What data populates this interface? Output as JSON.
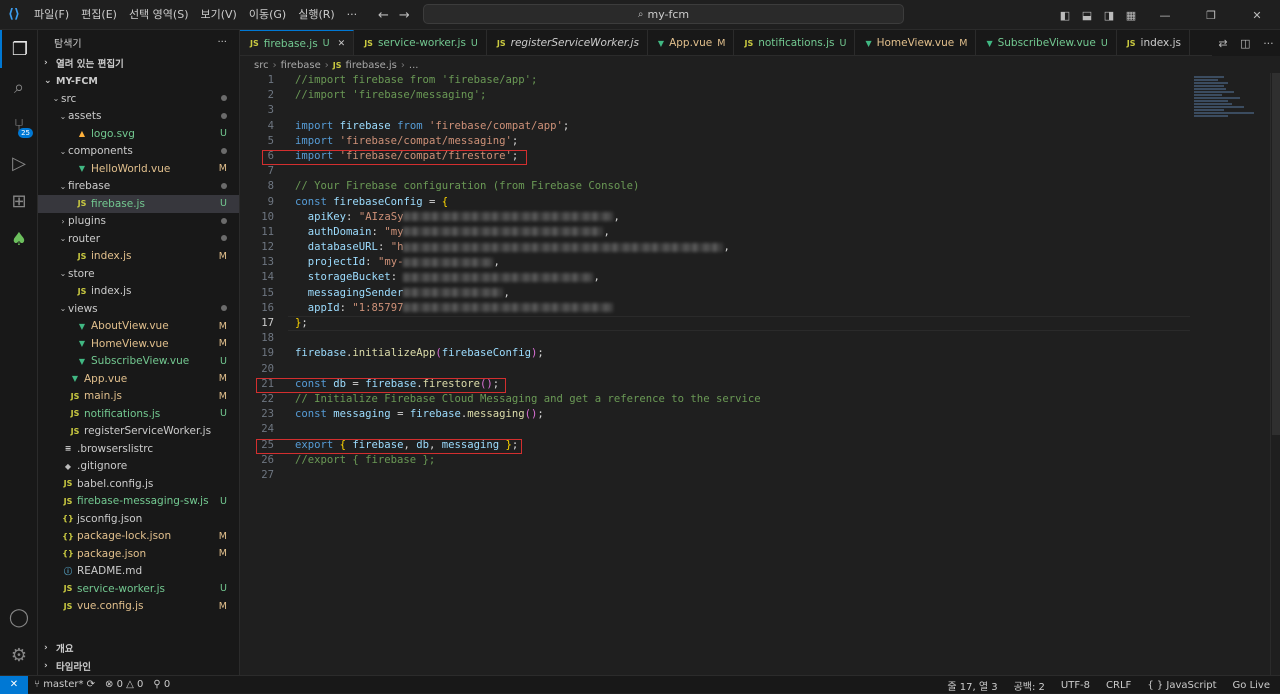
{
  "titlebar": {
    "menus": [
      "파일(F)",
      "편집(E)",
      "선택 영역(S)",
      "보기(V)",
      "이동(G)",
      "실행(R)",
      "···"
    ],
    "search_text": "my-fcm"
  },
  "activity": {
    "scm_badge": "25"
  },
  "explorer": {
    "title": "탐색기",
    "more": "···",
    "open_editors": "열려 있는 편집기",
    "project": "MY-FCM",
    "bottom_sections": [
      "개요",
      "타임라인"
    ],
    "tree": [
      {
        "label": "src",
        "depth": 1,
        "kind": "folder",
        "open": true,
        "status": "dot"
      },
      {
        "label": "assets",
        "depth": 2,
        "kind": "folder",
        "open": true,
        "status": "dot"
      },
      {
        "label": "logo.svg",
        "depth": 3,
        "kind": "svg",
        "status": "U"
      },
      {
        "label": "components",
        "depth": 2,
        "kind": "folder",
        "open": true,
        "status": "dot"
      },
      {
        "label": "HelloWorld.vue",
        "depth": 3,
        "kind": "vue",
        "status": "M"
      },
      {
        "label": "firebase",
        "depth": 2,
        "kind": "folder",
        "open": true,
        "status": "dot"
      },
      {
        "label": "firebase.js",
        "depth": 3,
        "kind": "js",
        "status": "U",
        "active": true
      },
      {
        "label": "plugins",
        "depth": 2,
        "kind": "folder",
        "open": false,
        "status": "dot"
      },
      {
        "label": "router",
        "depth": 2,
        "kind": "folder",
        "open": true,
        "status": "dot"
      },
      {
        "label": "index.js",
        "depth": 3,
        "kind": "js",
        "status": "M"
      },
      {
        "label": "store",
        "depth": 2,
        "kind": "folder",
        "open": true,
        "status": ""
      },
      {
        "label": "index.js",
        "depth": 3,
        "kind": "js",
        "status": ""
      },
      {
        "label": "views",
        "depth": 2,
        "kind": "folder",
        "open": true,
        "status": "dot"
      },
      {
        "label": "AboutView.vue",
        "depth": 3,
        "kind": "vue",
        "status": "M"
      },
      {
        "label": "HomeView.vue",
        "depth": 3,
        "kind": "vue",
        "status": "M"
      },
      {
        "label": "SubscribeView.vue",
        "depth": 3,
        "kind": "vue",
        "status": "U"
      },
      {
        "label": "App.vue",
        "depth": 2,
        "kind": "vue",
        "status": "M"
      },
      {
        "label": "main.js",
        "depth": 2,
        "kind": "js",
        "status": "M"
      },
      {
        "label": "notifications.js",
        "depth": 2,
        "kind": "js",
        "status": "U"
      },
      {
        "label": "registerServiceWorker.js",
        "depth": 2,
        "kind": "js",
        "status": ""
      },
      {
        "label": ".browserslistrc",
        "depth": 1,
        "kind": "plain",
        "status": ""
      },
      {
        "label": ".gitignore",
        "depth": 1,
        "kind": "git",
        "status": ""
      },
      {
        "label": "babel.config.js",
        "depth": 1,
        "kind": "js",
        "status": ""
      },
      {
        "label": "firebase-messaging-sw.js",
        "depth": 1,
        "kind": "js",
        "status": "U"
      },
      {
        "label": "jsconfig.json",
        "depth": 1,
        "kind": "json",
        "status": ""
      },
      {
        "label": "package-lock.json",
        "depth": 1,
        "kind": "json",
        "status": "M"
      },
      {
        "label": "package.json",
        "depth": 1,
        "kind": "json",
        "status": "M"
      },
      {
        "label": "README.md",
        "depth": 1,
        "kind": "info",
        "status": ""
      },
      {
        "label": "service-worker.js",
        "depth": 1,
        "kind": "js",
        "status": "U"
      },
      {
        "label": "vue.config.js",
        "depth": 1,
        "kind": "js",
        "status": "M"
      }
    ]
  },
  "tabs": [
    {
      "label": "firebase.js",
      "kind": "js",
      "status": "U",
      "active": true,
      "close": "✕"
    },
    {
      "label": "service-worker.js",
      "kind": "js",
      "status": "U"
    },
    {
      "label": "registerServiceWorker.js",
      "kind": "js",
      "status": "",
      "italic": true
    },
    {
      "label": "App.vue",
      "kind": "vue",
      "status": "M"
    },
    {
      "label": "notifications.js",
      "kind": "js",
      "status": "U"
    },
    {
      "label": "HomeView.vue",
      "kind": "vue",
      "status": "M"
    },
    {
      "label": "SubscribeView.vue",
      "kind": "vue",
      "status": "U"
    },
    {
      "label": "index.js",
      "kind": "js",
      "status": ""
    }
  ],
  "breadcrumb": [
    "src",
    "firebase",
    "firebase.js",
    "..."
  ],
  "code": [
    [
      [
        "cm",
        "//import firebase from 'firebase/app';"
      ]
    ],
    [
      [
        "cm",
        "//import 'firebase/messaging';"
      ]
    ],
    [],
    [
      [
        "k",
        "import "
      ],
      [
        "v",
        "firebase"
      ],
      [
        "k",
        " from "
      ],
      [
        "s",
        "'firebase/compat/app'"
      ],
      [
        "p",
        ";"
      ]
    ],
    [
      [
        "k",
        "import "
      ],
      [
        "s",
        "'firebase/compat/messaging'"
      ],
      [
        "p",
        ";"
      ]
    ],
    [
      [
        "k",
        "import "
      ],
      [
        "s",
        "'firebase/compat/firestore'"
      ],
      [
        "p",
        ";"
      ]
    ],
    [],
    [
      [
        "cm",
        "// Your Firebase configuration (from Firebase Console)"
      ]
    ],
    [
      [
        "k",
        "const "
      ],
      [
        "v",
        "firebaseConfig"
      ],
      [
        "p",
        " = "
      ],
      [
        "br",
        "{"
      ]
    ],
    [
      [
        "p",
        "  "
      ],
      [
        "v",
        "apiKey"
      ],
      [
        "p",
        ": "
      ],
      [
        "s",
        "\"AIzaSy"
      ],
      [
        "blur",
        "210"
      ],
      [
        "p",
        ","
      ]
    ],
    [
      [
        "p",
        "  "
      ],
      [
        "v",
        "authDomain"
      ],
      [
        "p",
        ": "
      ],
      [
        "s",
        "\"my"
      ],
      [
        "blur",
        "200"
      ],
      [
        "p",
        ","
      ]
    ],
    [
      [
        "p",
        "  "
      ],
      [
        "v",
        "databaseURL"
      ],
      [
        "p",
        ": "
      ],
      [
        "s",
        "\"h"
      ],
      [
        "blur",
        "320"
      ],
      [
        "p",
        ","
      ]
    ],
    [
      [
        "p",
        "  "
      ],
      [
        "v",
        "projectId"
      ],
      [
        "p",
        ": "
      ],
      [
        "s",
        "\"my-"
      ],
      [
        "blur",
        "90"
      ],
      [
        "p",
        ","
      ]
    ],
    [
      [
        "p",
        "  "
      ],
      [
        "v",
        "storageBucket"
      ],
      [
        "p",
        ": "
      ],
      [
        "blur",
        "190"
      ],
      [
        "p",
        ","
      ]
    ],
    [
      [
        "p",
        "  "
      ],
      [
        "v",
        "messagingSender"
      ],
      [
        "blur",
        "100"
      ],
      [
        "p",
        ","
      ]
    ],
    [
      [
        "p",
        "  "
      ],
      [
        "v",
        "appId"
      ],
      [
        "p",
        ": "
      ],
      [
        "s",
        "\"1:85797"
      ],
      [
        "blur",
        "210"
      ]
    ],
    [
      [
        "br",
        "}"
      ],
      [
        "p",
        ";"
      ]
    ],
    [],
    [
      [
        "v",
        "firebase"
      ],
      [
        "p",
        "."
      ],
      [
        "f",
        "initializeApp"
      ],
      [
        "br2",
        "("
      ],
      [
        "v",
        "firebaseConfig"
      ],
      [
        "br2",
        ")"
      ],
      [
        "p",
        ";"
      ]
    ],
    [],
    [
      [
        "k",
        "const "
      ],
      [
        "v",
        "db"
      ],
      [
        "p",
        " = "
      ],
      [
        "v",
        "firebase"
      ],
      [
        "p",
        "."
      ],
      [
        "f",
        "firestore"
      ],
      [
        "br2",
        "()"
      ],
      [
        "p",
        ";"
      ]
    ],
    [
      [
        "cm",
        "// Initialize Firebase Cloud Messaging and get a reference to the service"
      ]
    ],
    [
      [
        "k",
        "const "
      ],
      [
        "v",
        "messaging"
      ],
      [
        "p",
        " = "
      ],
      [
        "v",
        "firebase"
      ],
      [
        "p",
        "."
      ],
      [
        "f",
        "messaging"
      ],
      [
        "br2",
        "()"
      ],
      [
        "p",
        ";"
      ]
    ],
    [],
    [
      [
        "k",
        "export "
      ],
      [
        "br",
        "{ "
      ],
      [
        "v",
        "firebase"
      ],
      [
        "p",
        ", "
      ],
      [
        "v",
        "db"
      ],
      [
        "p",
        ", "
      ],
      [
        "v",
        "messaging"
      ],
      [
        "br",
        " }"
      ],
      [
        "p",
        ";"
      ]
    ],
    [
      [
        "cm",
        "//export { firebase };"
      ]
    ],
    []
  ],
  "current_line": 17,
  "status": {
    "branch": "master*",
    "errors": "0",
    "warnings": "0",
    "ports": "0",
    "right": [
      "줄 17, 열 3",
      "공백: 2",
      "UTF-8",
      "CRLF",
      "{ } JavaScript",
      "Go Live"
    ]
  }
}
